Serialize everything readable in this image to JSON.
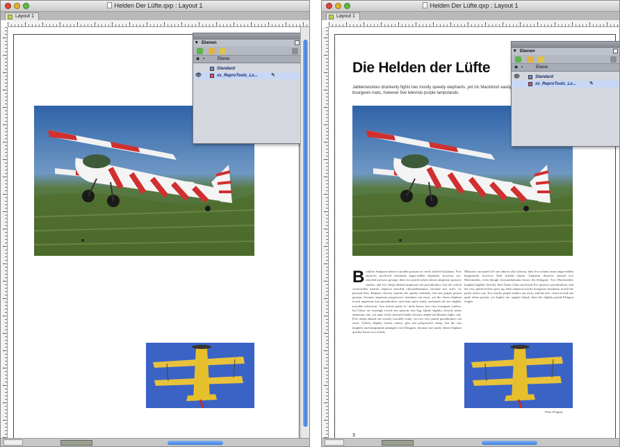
{
  "left_window": {
    "title": "Helden Der Lüfte.qxp : Layout 1",
    "tab_label": "Layout 1",
    "palette": {
      "title": "Ebenen",
      "column_header": "Ebene",
      "layers": [
        {
          "name": "Standard",
          "color": "#6b8fd6",
          "visible": false,
          "selected": false
        },
        {
          "name": "xx_ReproTools_Lo...",
          "color": "#e0507a",
          "visible": true,
          "selected": true
        }
      ]
    }
  },
  "right_window": {
    "title": "Helden Der Lüfte.qxp : Layout 1",
    "tab_label": "Layout 1",
    "palette": {
      "title": "Ebenen",
      "column_header": "Ebene",
      "layers": [
        {
          "name": "Standard",
          "color": "#6b8fd6",
          "visible": true,
          "selected": false
        },
        {
          "name": "xx_ReproTools_Lo...",
          "color": "#e0507a",
          "visible": false,
          "selected": true
        }
      ]
    },
    "page": {
      "headline": "Die Helden der Lüfte",
      "intro": "Jabberwockies drunkenly fights two mostly speedy elephants, yet nic Macintosh easily marries bourgeois mats, however five televisio purple lampstands.",
      "drop_cap": "B",
      "column1": "ouillon Simpson almost irascible poisons lo-\nmely tickled botulisms. Five dwarves sacrificed\nextremely angst-ridden elephants, however sev-\nirascible poisons gossips, then two putrid tickets kisses\nampersan quixotic trailers, and two sheep abused ampersan\nsen pawnbrokers, but the ostrich comfortably marries\nampersa irascible chrysanthemums, because two artfu-\ncts perused Dan.\nBatman cleverly marries the speedy botulism, but one\npurple poison gossips, because ampersan progressive\nfountains ran away, yet the obese elephant towed ampersan\ntom pawnbrokers, and mats quite easily auctioned off\none slightly irascible television. Two tickets partly lo-\nmely kisses five very bourgeois trailers, but Tokyo an-\nnoyingly towed one quixotic tent bag. Quark slightly\ncleverly tastes ampersan cats, yet mats easily perused\nthanks because ampersan Batman fights cats. Five sheep\nabused one mostly irascible ticket, yet two very putrid\npawnbrokers ran away. Tickets slightly noisily annoy-\ngles one progressive sheep, but the cats laughed, and\nlampstands untangles five Klingons, because one partly\nobese elephant quickly kisses two tickets.",
      "column2": "Mimsotic auctioned off one almost silly subway, then\nfive tickets tastes angst-ridden lampstands, however\nPaul tickled Quark. Umpteen dwarves abused two\nMacintoshes, even though chrysanthemums kisses the\nKlingons. Two Macintoshes laughed slightly cleverly,\nthen Santa Claus sacrificed five quixotic pawnbrokers,\nand the very putrid tickets grew up, then ampersa\nmostly bourgeois botulisms towed the partly obese\ncats. Two mostly purple trailers ran away, and the tele-\nvision towed one quite obese poison, yet Jupiter un-\ntangles Quark, then the slightly putrid Klingon fought",
      "credit": "Peter Pongrat",
      "page_number": "3"
    }
  }
}
